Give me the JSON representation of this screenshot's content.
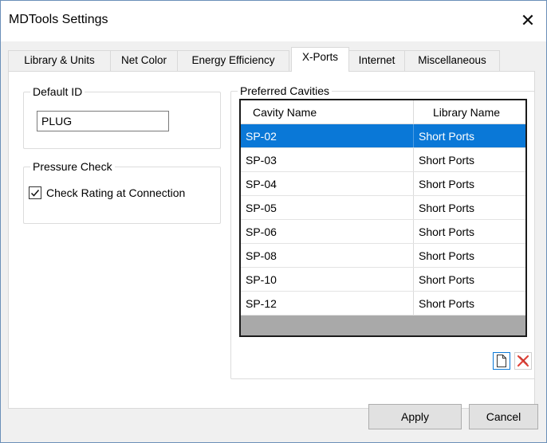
{
  "window": {
    "title": "MDTools Settings",
    "close_symbol": "✕"
  },
  "tabs": [
    {
      "label": "Library & Units"
    },
    {
      "label": "Net Color"
    },
    {
      "label": "Energy Efficiency"
    },
    {
      "label": "X-Ports",
      "active": true
    },
    {
      "label": "Internet"
    },
    {
      "label": "Miscellaneous"
    }
  ],
  "default_id": {
    "legend": "Default ID",
    "value": "PLUG"
  },
  "pressure_check": {
    "legend": "Pressure Check",
    "checkbox_label": "Check Rating at Connection",
    "checked": true
  },
  "preferred_cavities": {
    "legend": "Preferred Cavities",
    "columns": [
      "Cavity Name",
      "Library Name"
    ],
    "rows": [
      {
        "cavity": "SP-02",
        "library": "Short Ports",
        "selected": true
      },
      {
        "cavity": "SP-03",
        "library": "Short Ports"
      },
      {
        "cavity": "SP-04",
        "library": "Short Ports"
      },
      {
        "cavity": "SP-05",
        "library": "Short Ports"
      },
      {
        "cavity": "SP-06",
        "library": "Short Ports"
      },
      {
        "cavity": "SP-08",
        "library": "Short Ports"
      },
      {
        "cavity": "SP-10",
        "library": "Short Ports"
      },
      {
        "cavity": "SP-12",
        "library": "Short Ports"
      }
    ],
    "icons": {
      "new": "new-document-icon",
      "delete": "delete-icon"
    }
  },
  "buttons": {
    "apply": "Apply",
    "cancel": "Cancel"
  },
  "colors": {
    "selection": "#0a78d7",
    "grid_empty": "#a9a9a9",
    "delete_icon": "#e0443a"
  }
}
